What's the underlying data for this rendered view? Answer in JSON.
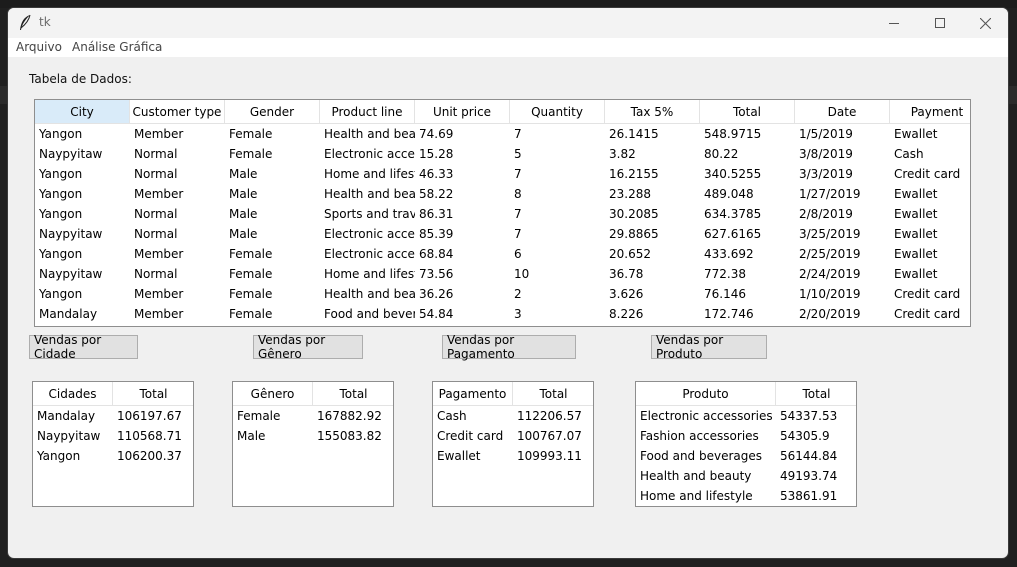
{
  "window": {
    "title": "tk"
  },
  "menu": [
    "Arquivo",
    "Análise Gráfica"
  ],
  "table_label": "Tabela de Dados:",
  "table": {
    "columns": [
      "City",
      "Customer type",
      "Gender",
      "Product line",
      "Unit price",
      "Quantity",
      "Tax 5%",
      "Total",
      "Date",
      "Payment"
    ],
    "rows": [
      [
        "Yangon",
        "Member",
        "Female",
        "Health and beauty",
        "74.69",
        "7",
        "26.1415",
        "548.9715",
        "1/5/2019",
        "Ewallet"
      ],
      [
        "Naypyitaw",
        "Normal",
        "Female",
        "Electronic accessories",
        "15.28",
        "5",
        "3.82",
        "80.22",
        "3/8/2019",
        "Cash"
      ],
      [
        "Yangon",
        "Normal",
        "Male",
        "Home and lifestyle",
        "46.33",
        "7",
        "16.2155",
        "340.5255",
        "3/3/2019",
        "Credit card"
      ],
      [
        "Yangon",
        "Member",
        "Male",
        "Health and beauty",
        "58.22",
        "8",
        "23.288",
        "489.048",
        "1/27/2019",
        "Ewallet"
      ],
      [
        "Yangon",
        "Normal",
        "Male",
        "Sports and travel",
        "86.31",
        "7",
        "30.2085",
        "634.3785",
        "2/8/2019",
        "Ewallet"
      ],
      [
        "Naypyitaw",
        "Normal",
        "Male",
        "Electronic accessories",
        "85.39",
        "7",
        "29.8865",
        "627.6165",
        "3/25/2019",
        "Ewallet"
      ],
      [
        "Yangon",
        "Member",
        "Female",
        "Electronic accessories",
        "68.84",
        "6",
        "20.652",
        "433.692",
        "2/25/2019",
        "Ewallet"
      ],
      [
        "Naypyitaw",
        "Normal",
        "Female",
        "Home and lifestyle",
        "73.56",
        "10",
        "36.78",
        "772.38",
        "2/24/2019",
        "Ewallet"
      ],
      [
        "Yangon",
        "Member",
        "Female",
        "Health and beauty",
        "36.26",
        "2",
        "3.626",
        "76.146",
        "1/10/2019",
        "Credit card"
      ],
      [
        "Mandalay",
        "Member",
        "Female",
        "Food and beverages",
        "54.84",
        "3",
        "8.226",
        "172.746",
        "2/20/2019",
        "Credit card"
      ]
    ]
  },
  "buttons": [
    "Vendas por Cidade",
    "Vendas por Gênero",
    "Vendas por Pagamento",
    "Vendas por Produto"
  ],
  "summaries": [
    {
      "headers": [
        "Cidades",
        "Total"
      ],
      "rows": [
        [
          "Mandalay",
          "106197.67"
        ],
        [
          "Naypyitaw",
          "110568.71"
        ],
        [
          "Yangon",
          "106200.37"
        ]
      ]
    },
    {
      "headers": [
        "Gênero",
        "Total"
      ],
      "rows": [
        [
          "Female",
          "167882.92"
        ],
        [
          "Male",
          "155083.82"
        ]
      ]
    },
    {
      "headers": [
        "Pagamento",
        "Total"
      ],
      "rows": [
        [
          "Cash",
          "112206.57"
        ],
        [
          "Credit card",
          "100767.07"
        ],
        [
          "Ewallet",
          "109993.11"
        ]
      ]
    },
    {
      "headers": [
        "Produto",
        "Total"
      ],
      "rows": [
        [
          "Electronic accessories",
          "54337.53"
        ],
        [
          "Fashion accessories",
          "54305.9"
        ],
        [
          "Food and beverages",
          "56144.84"
        ],
        [
          "Health and beauty",
          "49193.74"
        ],
        [
          "Home and lifestyle",
          "53861.91"
        ]
      ]
    }
  ],
  "colors": {
    "header_active": "#d9ebf9",
    "window_bg": "#f0f0f0",
    "button_bg": "#e1e1e1"
  },
  "icons": {
    "app": "feather-icon",
    "minimize": "minimize-icon",
    "maximize": "maximize-icon",
    "close": "close-icon"
  }
}
